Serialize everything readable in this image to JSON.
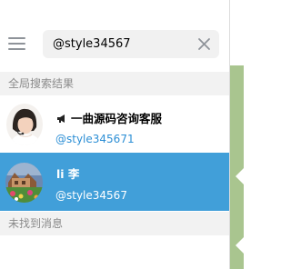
{
  "search": {
    "value": "@style34567"
  },
  "sections": {
    "global_results": "全局搜索结果",
    "no_messages": "未找到消息"
  },
  "results": [
    {
      "title": "一曲源码咨询客服",
      "subtitle": "@style345671",
      "icon": "megaphone-icon"
    },
    {
      "title": "li 李",
      "subtitle": "@style34567"
    }
  ],
  "colors": {
    "selected_row": "#419fd9",
    "link": "#2d8fd5",
    "section_bg": "#f2f2f2",
    "search_bg": "#f1f1f1"
  }
}
